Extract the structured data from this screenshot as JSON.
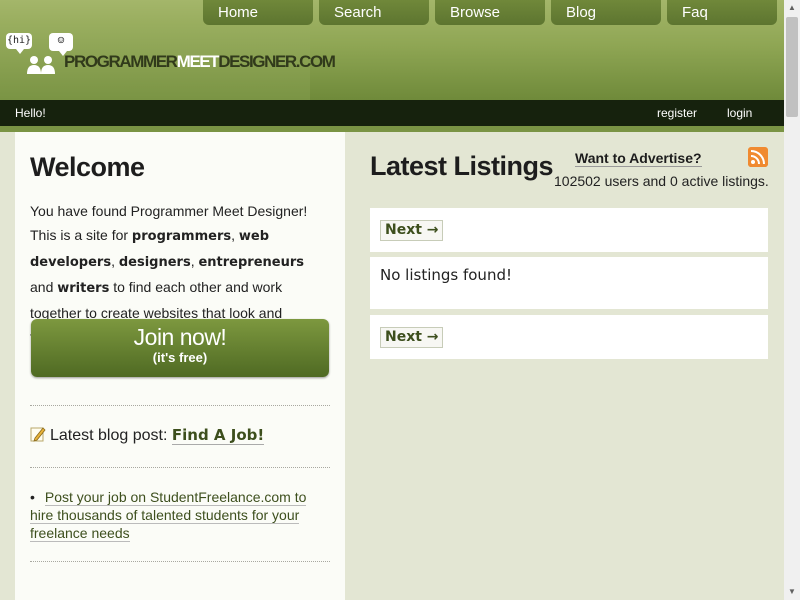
{
  "logo": {
    "bubble_hi": "{hi}",
    "bubble_art": "☺",
    "part1": "PROGRAMMER",
    "part2": "MEET",
    "part3": "DESIGNER.COM"
  },
  "nav": [
    "Home",
    "Search",
    "Browse",
    "Blog",
    "Faq"
  ],
  "topbar": {
    "greeting": "Hello!",
    "register": "register",
    "login": "login"
  },
  "welcome": {
    "title": "Welcome",
    "intro": {
      "t1": "You have found Programmer Meet Designer! This is a site for ",
      "b1": "programmers",
      "t2": ", ",
      "b2": "web developers",
      "t3": ", ",
      "b3": "designers",
      "t4": ", ",
      "b4": "entrepreneurs",
      "t5": " and ",
      "b5": "writers",
      "t6": " to find each other and work together to create websites that look and function great."
    },
    "join_label": "Join now!",
    "join_sub": "(it's free)"
  },
  "blog": {
    "prefix": "Latest blog post:",
    "link": "Find A Job!"
  },
  "promo": {
    "bullet": "•",
    "text": "Post your job on StudentFreelance.com to hire thousands of talented students for your freelance needs"
  },
  "listings": {
    "title": "Latest Listings",
    "advertise": "Want to Advertise?",
    "stats": "102502 users and 0 active listings.",
    "next_label": "Next →",
    "empty": "No listings found!"
  },
  "colors": {
    "nav_bg": "#5d7530",
    "topbar_bg": "#16220d",
    "accent": "#3d4f1d",
    "rss": "#f08a30"
  }
}
